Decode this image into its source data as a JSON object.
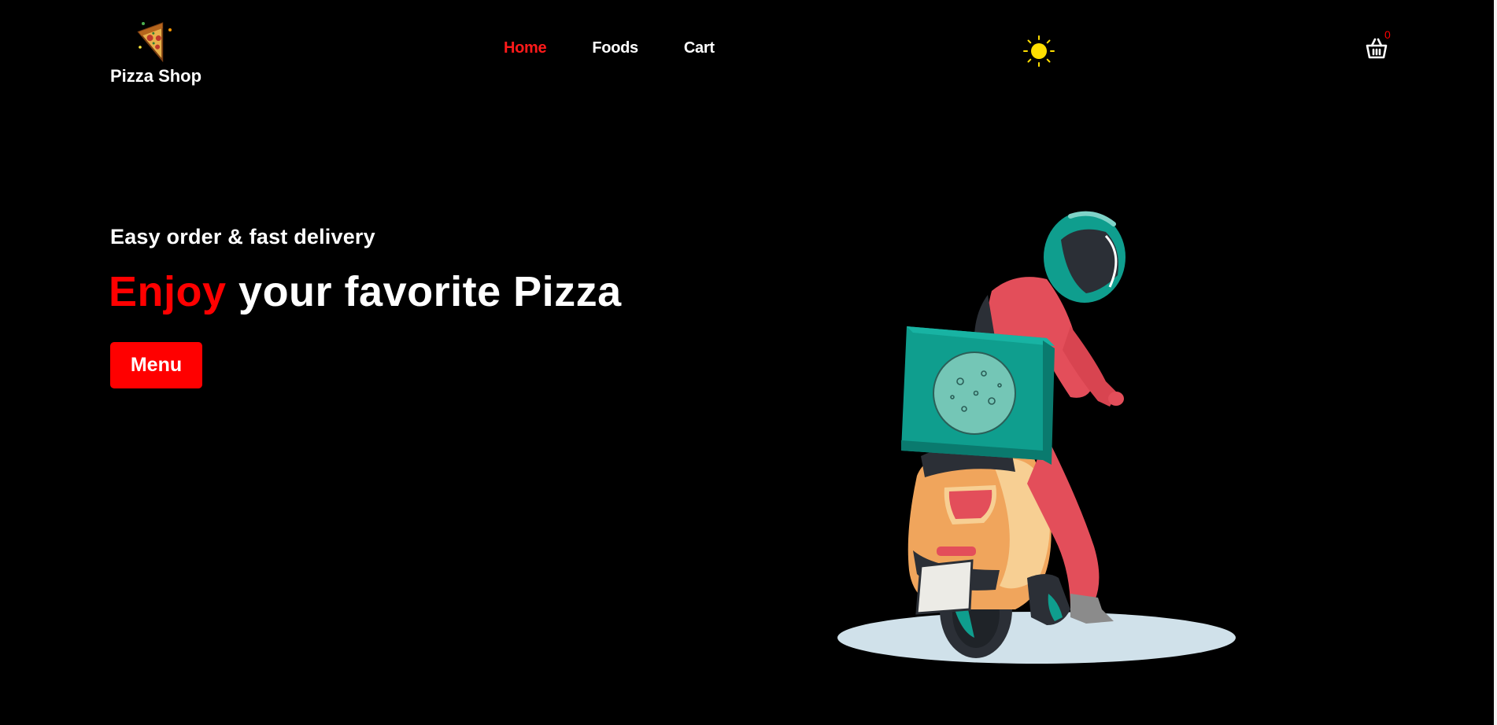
{
  "header": {
    "brand_name": "Pizza Shop",
    "logo_icon": "pizza-slice-logo",
    "nav": [
      {
        "label": "Home",
        "active": true
      },
      {
        "label": "Foods",
        "active": false
      },
      {
        "label": "Cart",
        "active": false
      }
    ],
    "theme_icon": "sun-icon",
    "cart_icon": "shopping-basket-icon",
    "cart_count": "0"
  },
  "hero": {
    "tagline": "Easy order & fast delivery",
    "headline_accent": "Enjoy",
    "headline_rest": " your favorite Pizza",
    "cta_label": "Menu",
    "illustration": "delivery-rider-on-scooter"
  },
  "colors": {
    "background": "#000000",
    "accent": "#ff0000",
    "text": "#ffffff",
    "sun": "#ffdf00"
  }
}
